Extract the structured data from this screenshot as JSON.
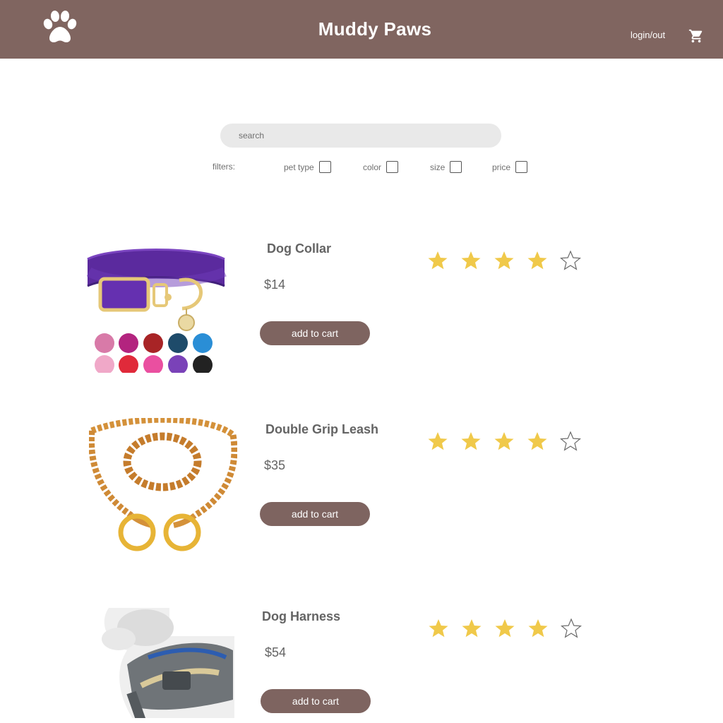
{
  "header": {
    "brand": "Muddy Paws",
    "login_label": "login/out",
    "bg_color": "#806560"
  },
  "search": {
    "placeholder": "search",
    "value": ""
  },
  "filters": {
    "label": "filters:",
    "options": [
      {
        "label": "pet type",
        "checked": false
      },
      {
        "label": "color",
        "checked": false
      },
      {
        "label": "size",
        "checked": false
      },
      {
        "label": "price",
        "checked": false
      }
    ]
  },
  "products": [
    {
      "title": "Dog Collar",
      "price": "$14",
      "button": "add to cart",
      "rating": 4,
      "rating_max": 5
    },
    {
      "title": "Double Grip Leash",
      "price": "$35",
      "button": "add to cart",
      "rating": 4,
      "rating_max": 5
    },
    {
      "title": "Dog Harness",
      "price": "$54",
      "button": "add to cart",
      "rating": 4,
      "rating_max": 5
    }
  ],
  "colors": {
    "accent": "#7e6460",
    "star_filled": "#f0c94a",
    "star_empty_stroke": "#6b6b6b"
  },
  "icons": {
    "logo": "paw-icon",
    "cart": "cart-icon",
    "rating": "star-icon"
  }
}
